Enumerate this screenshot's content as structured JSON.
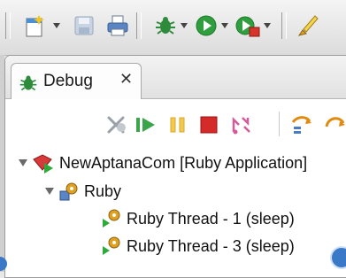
{
  "toolbar": {
    "items": [
      "new-wizard-icon",
      "save-icon",
      "print-icon",
      "debug-icon",
      "run-icon",
      "external-tools-icon",
      "brush-icon"
    ]
  },
  "debug_view": {
    "tab_label": "Debug",
    "close_glyph": "✕",
    "toolbar_items": [
      "remove-terminated-icon",
      "resume-icon",
      "suspend-icon",
      "terminate-icon",
      "disconnect-icon",
      "step-into-icon",
      "step-over-icon"
    ]
  },
  "tree": [
    {
      "label": "NewAptanaCom [Ruby Application]",
      "expanded": true
    },
    {
      "label": "Ruby",
      "expanded": true
    },
    {
      "label": "Ruby Thread - 1 (sleep)"
    },
    {
      "label": "Ruby Thread - 3 (sleep)"
    }
  ],
  "colors": {
    "terminate": "#d42a2a",
    "resume": "#3aa54a",
    "suspend": "#f2c94c",
    "debug_bug": "#2e8b3c",
    "thread_play": "#2eaa3a"
  }
}
